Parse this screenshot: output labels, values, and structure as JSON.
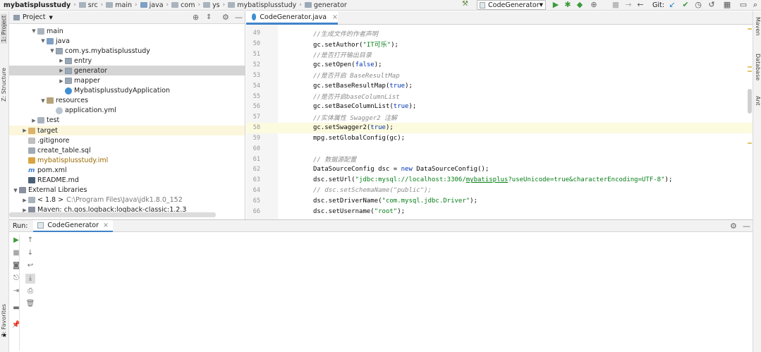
{
  "breadcrumbs": [
    {
      "label": "mybatisplusstudy",
      "bold": true,
      "icon": ""
    },
    {
      "label": "src",
      "icon": "folder"
    },
    {
      "label": "main",
      "icon": "folder"
    },
    {
      "label": "java",
      "icon": "folder-blue"
    },
    {
      "label": "com",
      "icon": "folder"
    },
    {
      "label": "ys",
      "icon": "folder"
    },
    {
      "label": "mybatisplusstudy",
      "icon": "folder"
    },
    {
      "label": "generator",
      "icon": "package"
    }
  ],
  "toolbar": {
    "run_config": "CodeGenerator",
    "git_label": "Git:"
  },
  "left_stripe": {
    "project_tab": "1: Project",
    "structure_tab": "Z: Structure",
    "favorites_tab": "2: Favorites"
  },
  "right_stripe": {
    "maven_tab": "Maven",
    "database_tab": "Database",
    "ant_tab": "Ant"
  },
  "project": {
    "title": "Project",
    "tree": [
      {
        "label": "main",
        "indent": 2,
        "expanded": true,
        "icon": "folder"
      },
      {
        "label": "java",
        "indent": 3,
        "expanded": true,
        "icon": "src"
      },
      {
        "label": "com.ys.mybatisplusstudy",
        "indent": 4,
        "expanded": true,
        "icon": "pkg"
      },
      {
        "label": "entry",
        "indent": 5,
        "expanded": false,
        "icon": "pkg"
      },
      {
        "label": "generator",
        "indent": 5,
        "expanded": false,
        "icon": "pkg",
        "selected": true
      },
      {
        "label": "mapper",
        "indent": 5,
        "expanded": false,
        "icon": "pkg"
      },
      {
        "label": "MybatisplusstudyApplication",
        "indent": 5,
        "leaf": true,
        "icon": "java"
      },
      {
        "label": "resources",
        "indent": 3,
        "expanded": true,
        "icon": "res"
      },
      {
        "label": "application.yml",
        "indent": 4,
        "leaf": true,
        "icon": "yml"
      },
      {
        "label": "test",
        "indent": 2,
        "expanded": false,
        "icon": "test"
      },
      {
        "label": "target",
        "indent": 1,
        "expanded": false,
        "icon": "target",
        "target": true
      },
      {
        "label": ".gitignore",
        "indent": 1,
        "leaf": true,
        "icon": "git"
      },
      {
        "label": "create_table.sql",
        "indent": 1,
        "leaf": true,
        "icon": "sql"
      },
      {
        "label": "mybatisplusstudy.iml",
        "indent": 1,
        "leaf": true,
        "icon": "iml",
        "yellow": true
      },
      {
        "label": "pom.xml",
        "indent": 1,
        "leaf": true,
        "icon": "m"
      },
      {
        "label": "README.md",
        "indent": 1,
        "leaf": true,
        "icon": "md"
      },
      {
        "label": "External Libraries",
        "indent": 0,
        "expanded": true,
        "icon": "lib"
      },
      {
        "label": "< 1.8 >",
        "sub": "C:\\Program Files\\Java\\jdk1.8.0_152",
        "indent": 1,
        "expanded": false,
        "icon": "folder"
      },
      {
        "label": "Maven: ch.qos.logback:logback-classic:1.2.3",
        "indent": 1,
        "expanded": false,
        "icon": "lib"
      }
    ]
  },
  "editor": {
    "tab_label": "CodeGenerator.java",
    "lines": [
      {
        "num": "49",
        "html": "<span class=\"c-comment\">//生成文件的作者声明</span>"
      },
      {
        "num": "50",
        "html": "gc.setAuthor(<span class=\"c-str\">\"IT可乐\"</span>);"
      },
      {
        "num": "51",
        "html": "<span class=\"c-comment\">//是否打开输出目录</span>"
      },
      {
        "num": "52",
        "html": "gc.setOpen(<span class=\"c-bool\">false</span>);"
      },
      {
        "num": "53",
        "html": "<span class=\"c-comment\">//是否开启 BaseResultMap</span>"
      },
      {
        "num": "54",
        "html": "gc.setBaseResultMap(<span class=\"c-bool\">true</span>);"
      },
      {
        "num": "55",
        "html": "<span class=\"c-comment\">//是否开启baseColumnList</span>"
      },
      {
        "num": "56",
        "html": "gc.setBaseColumnList(<span class=\"c-bool\">true</span>);"
      },
      {
        "num": "57",
        "html": "<span class=\"c-comment\">//实体属性 Swagger2 注解</span>"
      },
      {
        "num": "58",
        "html": "gc.setSwagger2(<span class=\"c-bool\">true</span>);",
        "highlight": true
      },
      {
        "num": "59",
        "html": "mpg.setGlobalConfig(gc);"
      },
      {
        "num": "60",
        "html": ""
      },
      {
        "num": "61",
        "html": "<span class=\"c-comment\">// 数据源配置</span>"
      },
      {
        "num": "62",
        "html": "DataSourceConfig dsc = <span class=\"c-kw\">new</span> DataSourceConfig();"
      },
      {
        "num": "63",
        "html": "dsc.setUrl(<span class=\"c-str\">\"jdbc:mysql://localhost:3306/<span class=\"c-url\">mybatisplus</span>?useUnicode=true&amp;characterEncoding=UTF-8\"</span>);"
      },
      {
        "num": "64",
        "html": "<span class=\"c-comment\">// dsc.setSchemaName(\"public\");</span>"
      },
      {
        "num": "65",
        "html": "dsc.setDriverName(<span class=\"c-str\">\"com.mysql.jdbc.Driver\"</span>);"
      },
      {
        "num": "66",
        "html": "dsc.setUsername(<span class=\"c-str\">\"root\"</span>);"
      }
    ]
  },
  "run": {
    "label": "Run:",
    "tab_label": "CodeGenerator"
  },
  "colors": {
    "accent": "#4083c9",
    "run_green": "#3c9a3c"
  }
}
